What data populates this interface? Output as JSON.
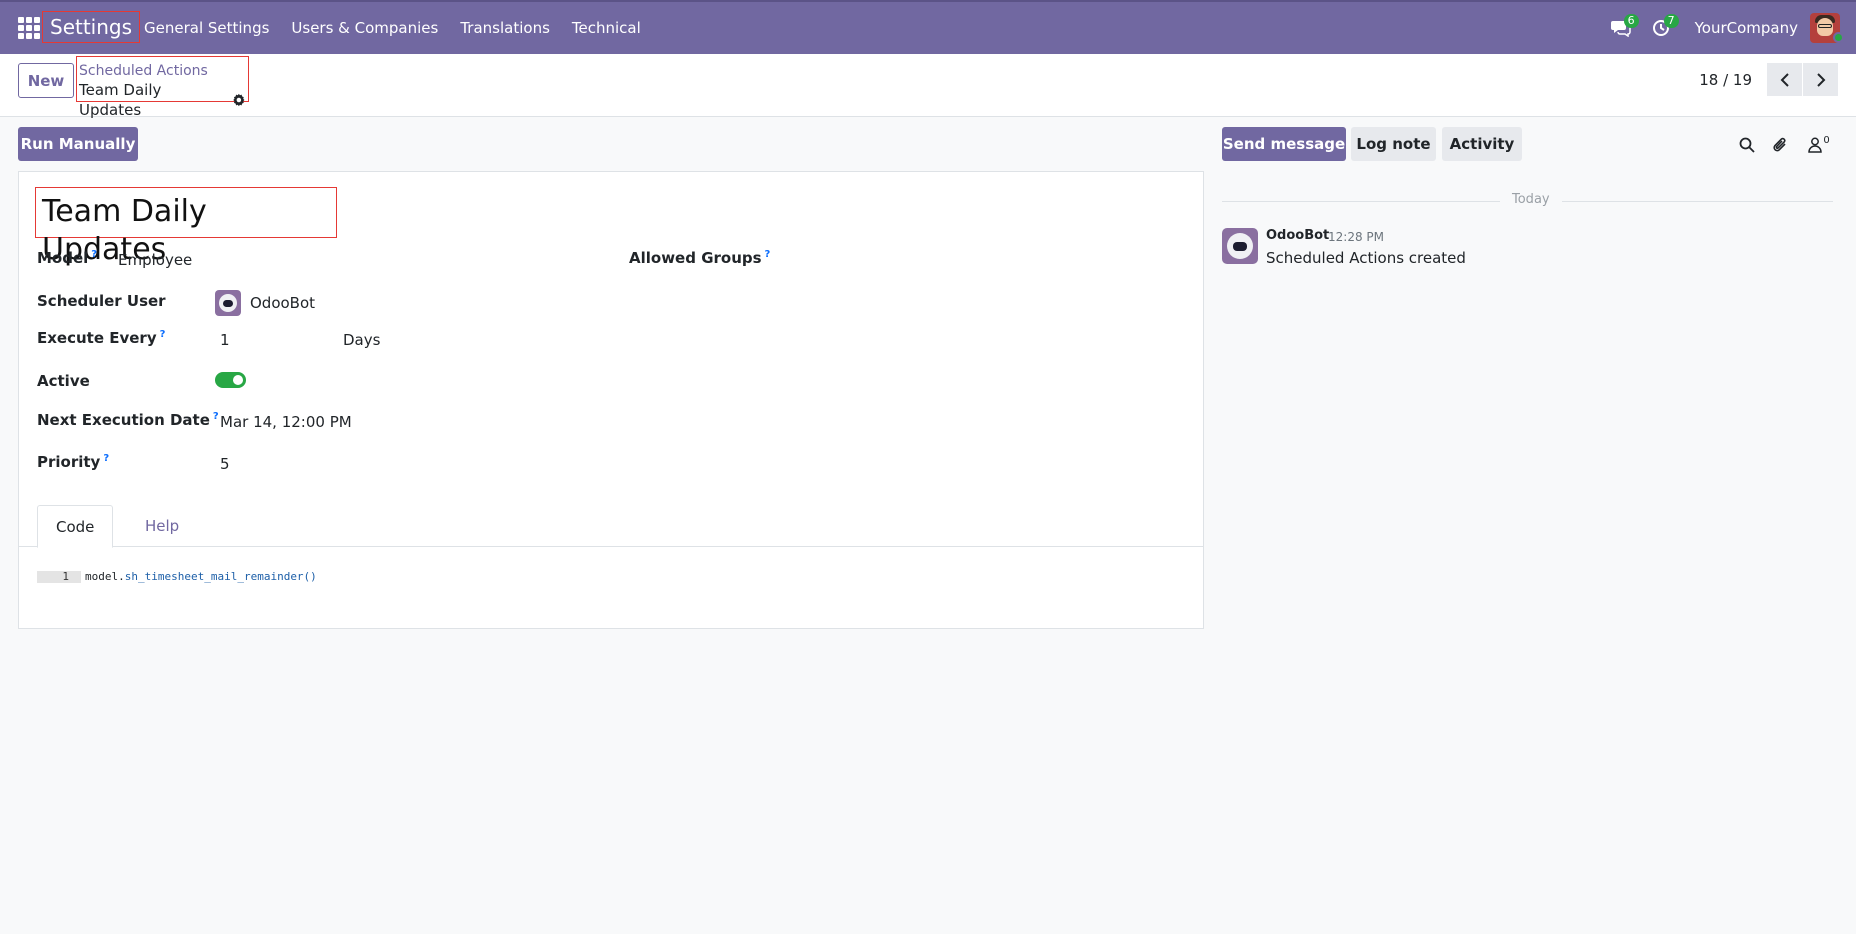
{
  "navbar": {
    "app_name": "Settings",
    "menu": [
      "General Settings",
      "Users & Companies",
      "Translations",
      "Technical"
    ],
    "messages_count": "6",
    "activities_count": "7",
    "company": "YourCompany"
  },
  "control_panel": {
    "new_label": "New",
    "breadcrumb_parent": "Scheduled Actions",
    "breadcrumb_current": "Team Daily Updates",
    "pager_value": "18 / 19"
  },
  "actions": {
    "run_manually": "Run Manually"
  },
  "chatter_actions": {
    "send_message": "Send message",
    "log_note": "Log note",
    "activity": "Activity",
    "followers_count": "0"
  },
  "form": {
    "title": "Team Daily Updates",
    "model_label": "Model",
    "model_value": "Employee",
    "allowed_groups_label": "Allowed Groups",
    "scheduler_user_label": "Scheduler User",
    "scheduler_user_value": "OdooBot",
    "execute_every_label": "Execute Every",
    "execute_every_value": "1",
    "execute_every_unit": "Days",
    "active_label": "Active",
    "active": true,
    "next_execution_label": "Next Execution Date",
    "next_execution_value": "Mar 14, 12:00 PM",
    "priority_label": "Priority",
    "priority_value": "5",
    "help_mark": "?"
  },
  "tabs": [
    "Code",
    "Help"
  ],
  "code": {
    "line_number": "1",
    "object": "model",
    "dot": ".",
    "method": "sh_timesheet_mail_remainder()"
  },
  "chatter": {
    "date_divider": "Today",
    "message": {
      "author": "OdooBot",
      "time": "12:28 PM",
      "body": "Scheduled Actions created"
    }
  },
  "colors": {
    "brand": "#7168a1",
    "highlight": "#e53935",
    "toggle_on": "#28a745",
    "badge": "#28a745"
  }
}
